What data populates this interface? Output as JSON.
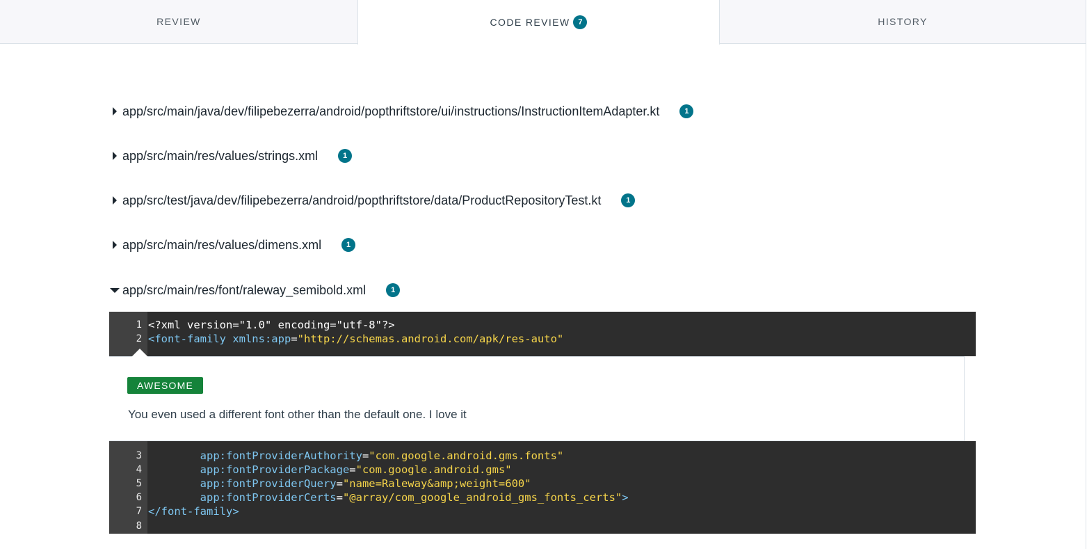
{
  "tabs": [
    {
      "label": "REVIEW"
    },
    {
      "label": "CODE REVIEW",
      "badge": "7"
    },
    {
      "label": "HISTORY"
    }
  ],
  "files": [
    {
      "path": "app/src/main/java/dev/filipebezerra/android/popthriftstore/ui/instructions/InstructionItemAdapter.kt",
      "count": "1",
      "expanded": false
    },
    {
      "path": "app/src/main/res/values/strings.xml",
      "count": "1",
      "expanded": false
    },
    {
      "path": "app/src/test/java/dev/filipebezerra/android/popthriftstore/data/ProductRepositoryTest.kt",
      "count": "1",
      "expanded": false
    },
    {
      "path": "app/src/main/res/values/dimens.xml",
      "count": "1",
      "expanded": false
    },
    {
      "path": "app/src/main/res/font/raleway_semibold.xml",
      "count": "1",
      "expanded": true
    }
  ],
  "code": {
    "line1": {
      "num": "1",
      "text": "<?xml version=\"1.0\" encoding=\"utf-8\"?>"
    },
    "line2": {
      "num": "2",
      "tag": "<font-family",
      "attr": " xmlns:app",
      "eq": "=",
      "val": "\"http://schemas.android.com/apk/res-auto\""
    },
    "line3": {
      "num": "3",
      "attr": "        app:fontProviderAuthority",
      "eq": "=",
      "val": "\"com.google.android.gms.fonts\""
    },
    "line4": {
      "num": "4",
      "attr": "        app:fontProviderPackage",
      "eq": "=",
      "val": "\"com.google.android.gms\""
    },
    "line5": {
      "num": "5",
      "attr": "        app:fontProviderQuery",
      "eq": "=",
      "val": "\"name=Raleway&amp;weight=600\""
    },
    "line6": {
      "num": "6",
      "attr": "        app:fontProviderCerts",
      "eq": "=",
      "val": "\"@array/com_google_android_gms_fonts_certs\"",
      "end": ">"
    },
    "line7": {
      "num": "7",
      "text": "</font-family>"
    },
    "line8": {
      "num": "8",
      "text": ""
    }
  },
  "comment": {
    "tag": "AWESOME",
    "text": "You even used a different font other than the default one. I love it"
  },
  "colors": {
    "badge": "#02748a",
    "awesome": "#15833a",
    "code_bg": "#2d2d2d",
    "gutter_bg": "#414141"
  }
}
